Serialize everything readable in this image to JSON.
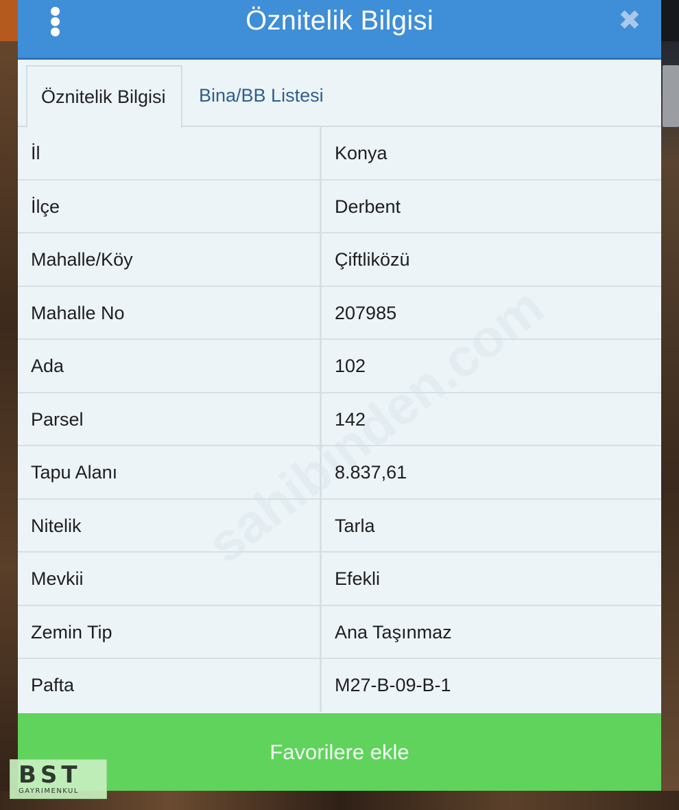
{
  "header": {
    "title": "Öznitelik Bilgisi",
    "close_symbol": "✖",
    "menu_icon": "vertical-dots-icon"
  },
  "tabs": [
    {
      "label": "Öznitelik Bilgisi",
      "active": true
    },
    {
      "label": "Bina/BB Listesi",
      "active": false
    }
  ],
  "attributes": [
    {
      "label": "İl",
      "value": "Konya"
    },
    {
      "label": "İlçe",
      "value": "Derbent"
    },
    {
      "label": "Mahalle/Köy",
      "value": "Çiftliközü"
    },
    {
      "label": "Mahalle No",
      "value": "207985"
    },
    {
      "label": "Ada",
      "value": "102"
    },
    {
      "label": "Parsel",
      "value": "142"
    },
    {
      "label": "Tapu Alanı",
      "value": "8.837,61"
    },
    {
      "label": "Nitelik",
      "value": "Tarla"
    },
    {
      "label": "Mevkii",
      "value": "Efekli"
    },
    {
      "label": "Zemin Tip",
      "value": "Ana Taşınmaz"
    },
    {
      "label": "Pafta",
      "value": "M27-B-09-B-1"
    }
  ],
  "actions": {
    "favorite_label": "Favorilere ekle"
  },
  "watermark": "sahibinden.com",
  "logo": {
    "main": "BST",
    "sub": "GAYRIMENKUL"
  },
  "colors": {
    "header": "#3f8ed8",
    "button": "#5fd35c",
    "panel": "#ecf4f8"
  }
}
